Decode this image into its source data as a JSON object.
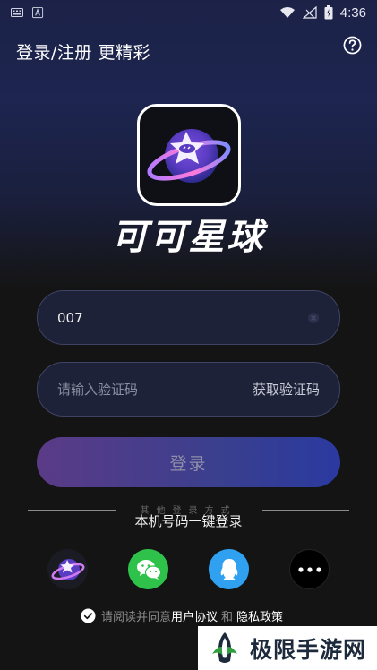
{
  "status_bar": {
    "time": "4:36",
    "left_icons": [
      "keyboard-icon",
      "accessibility-icon"
    ],
    "right_icons": [
      "wifi-icon",
      "signal-icon",
      "battery-icon"
    ]
  },
  "header": {
    "title": "登录/注册 更精彩",
    "help_icon": "help-icon"
  },
  "brand": {
    "name": "可可星球"
  },
  "phone_field": {
    "value": "007"
  },
  "code_field": {
    "placeholder": "请输入验证码",
    "get_code_label": "获取验证码"
  },
  "login_button": {
    "label": "登录"
  },
  "other_login": {
    "label": "其他登录方式",
    "one_key_label": "本机号码一键登录",
    "providers": [
      "planet-app-icon",
      "wechat-icon",
      "qq-icon",
      "more-icon"
    ]
  },
  "agreement": {
    "prefix": "请阅读并同意",
    "user_agreement": "用户协议",
    "and": "和",
    "privacy_policy": "隐私政策"
  },
  "watermark": {
    "text": "极限手游网"
  },
  "colors": {
    "accent_gradient_start": "#5b3b87",
    "accent_gradient_end": "#2b3aa0",
    "background": "#141414"
  }
}
